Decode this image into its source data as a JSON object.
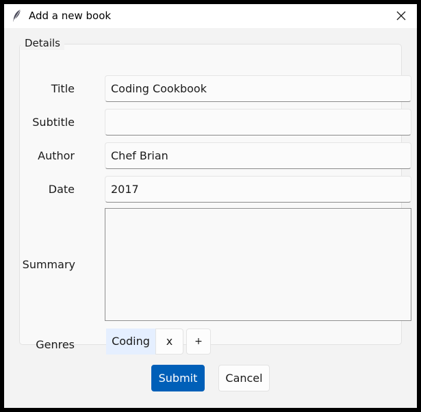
{
  "window": {
    "title": "Add a new book",
    "icon": "feather-icon",
    "close_icon": "close-icon"
  },
  "form": {
    "group_label": "Details",
    "fields": {
      "title": {
        "label": "Title",
        "value": "Coding Cookbook"
      },
      "subtitle": {
        "label": "Subtitle",
        "value": ""
      },
      "author": {
        "label": "Author",
        "value": "Chef Brian"
      },
      "date": {
        "label": "Date",
        "value": "2017"
      },
      "summary": {
        "label": "Summary",
        "value": ""
      }
    },
    "genres": {
      "label": "Genres",
      "items": [
        "Coding"
      ],
      "remove_label": "x",
      "add_label": "+"
    }
  },
  "actions": {
    "submit_label": "Submit",
    "cancel_label": "Cancel"
  },
  "colors": {
    "accent": "#005fb8",
    "chip_bg": "#e5efff"
  }
}
